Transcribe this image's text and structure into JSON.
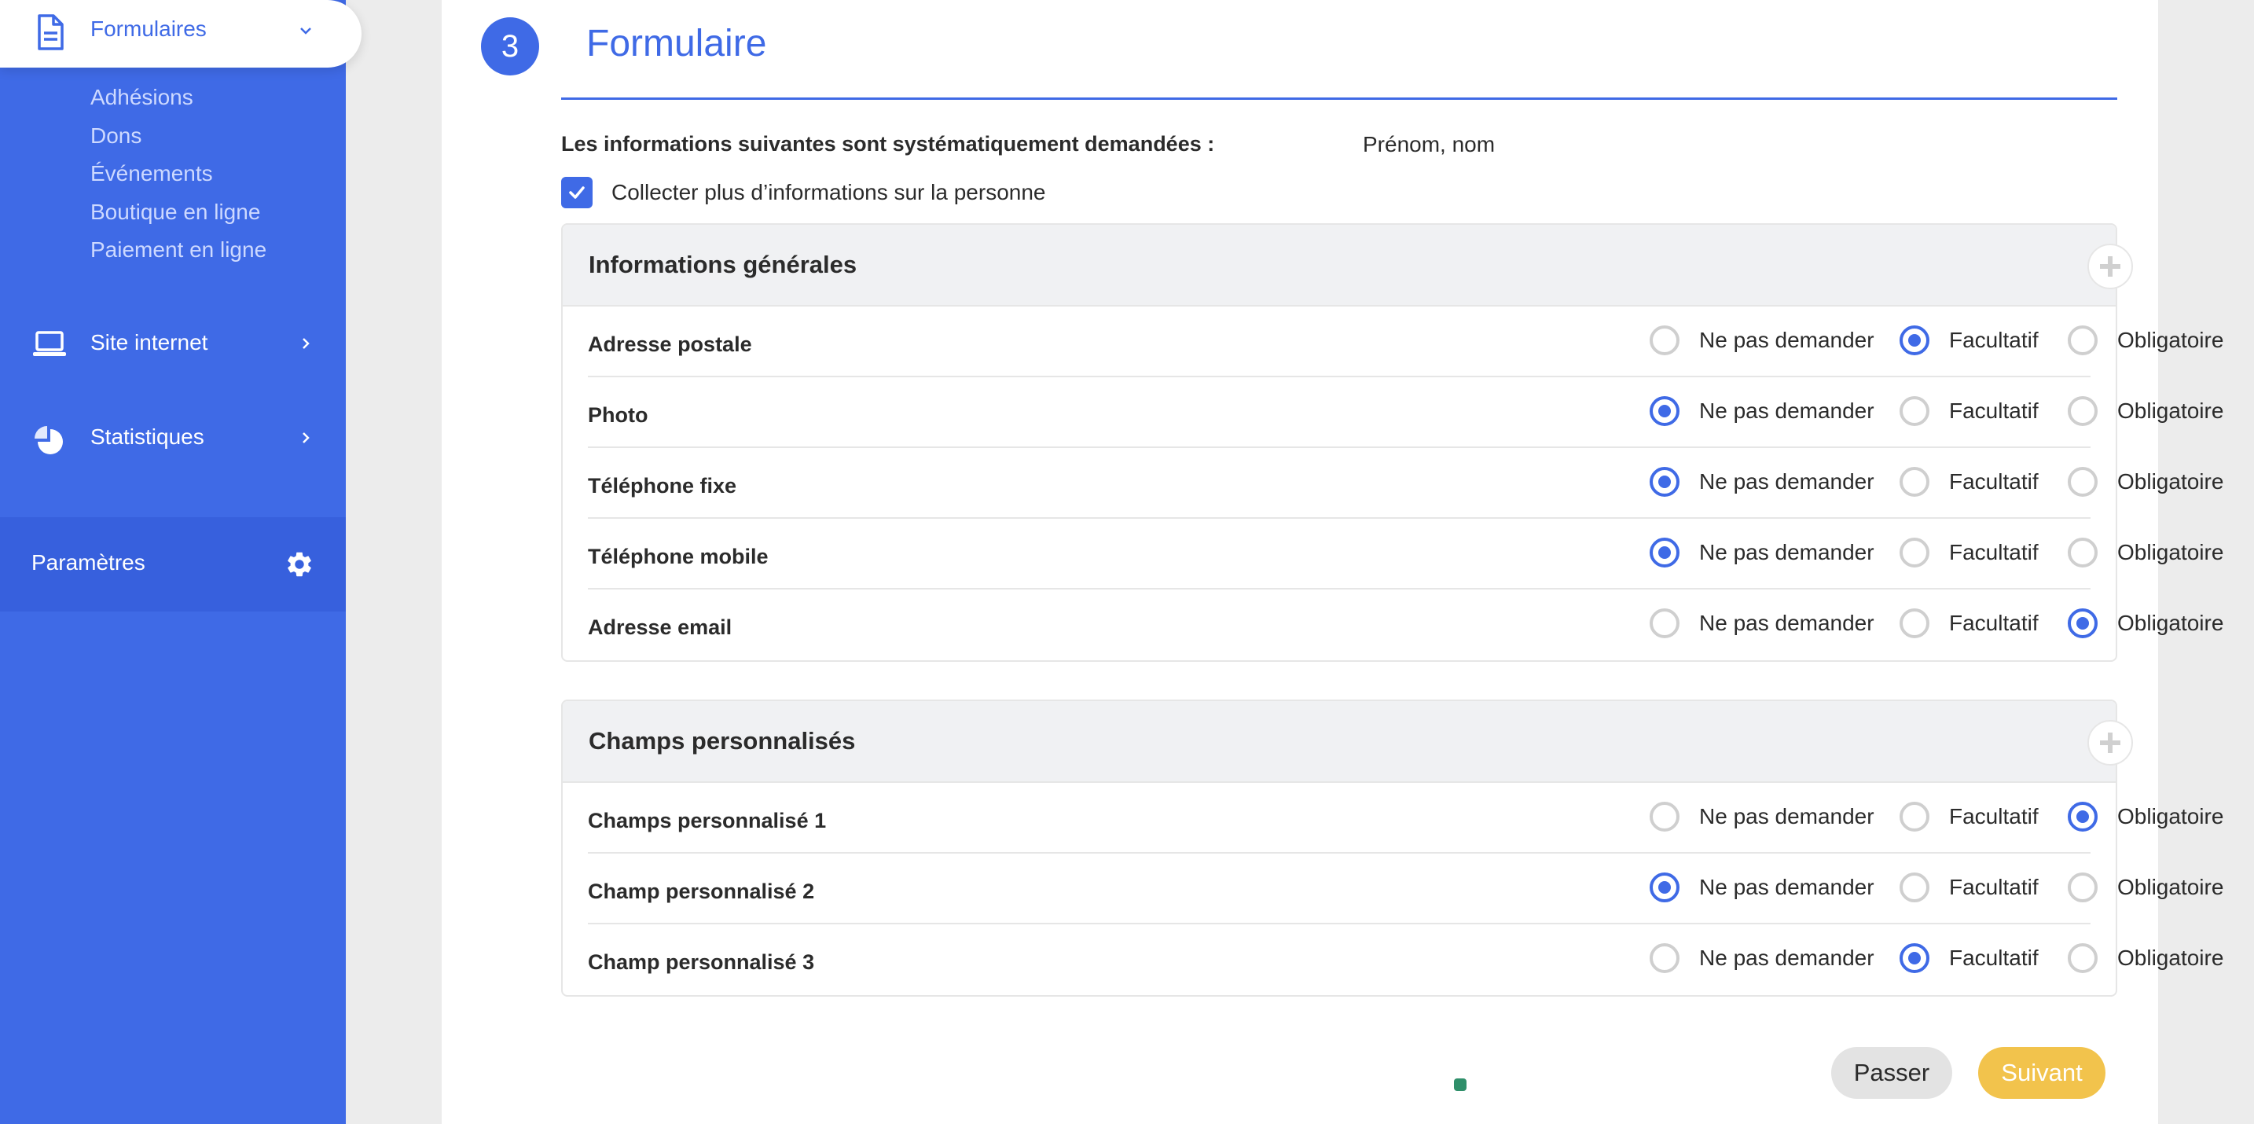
{
  "colors": {
    "primary": "#3f6ae6",
    "accent_yellow": "#f2c34c",
    "status_dot": "#2f8f6a"
  },
  "sidebar": {
    "active": {
      "label": "Formulaires",
      "icon": "document-icon"
    },
    "subitems": [
      "Adhésions",
      "Dons",
      "Événements",
      "Boutique en ligne",
      "Paiement en ligne"
    ],
    "items": [
      {
        "label": "Site internet",
        "icon": "laptop-icon"
      },
      {
        "label": "Statistiques",
        "icon": "pie-chart-icon"
      }
    ],
    "settings": {
      "label": "Paramètres",
      "icon": "gear-icon"
    }
  },
  "step": {
    "number": "3",
    "title": "Formulaire"
  },
  "info": {
    "label": "Les informations suivantes sont systématiquement demandées :",
    "value": "Prénom, nom"
  },
  "collect": {
    "label": "Collecter plus d’informations sur la personne",
    "checked": true
  },
  "options": [
    "Ne pas demander",
    "Facultatif",
    "Obligatoire"
  ],
  "sections": [
    {
      "title": "Informations générales",
      "rows": [
        {
          "label": "Adresse postale",
          "selected": "Facultatif"
        },
        {
          "label": "Photo",
          "selected": "Ne pas demander"
        },
        {
          "label": "Téléphone fixe",
          "selected": "Ne pas demander"
        },
        {
          "label": "Téléphone mobile",
          "selected": "Ne pas demander"
        },
        {
          "label": "Adresse email",
          "selected": "Obligatoire"
        }
      ]
    },
    {
      "title": "Champs personnalisés",
      "rows": [
        {
          "label": "Champs personnalisé 1",
          "selected": "Obligatoire"
        },
        {
          "label": "Champ personnalisé 2",
          "selected": "Ne pas demander"
        },
        {
          "label": "Champ personnalisé 3",
          "selected": "Facultatif"
        }
      ]
    }
  ],
  "buttons": {
    "skip": "Passer",
    "next": "Suivant"
  }
}
